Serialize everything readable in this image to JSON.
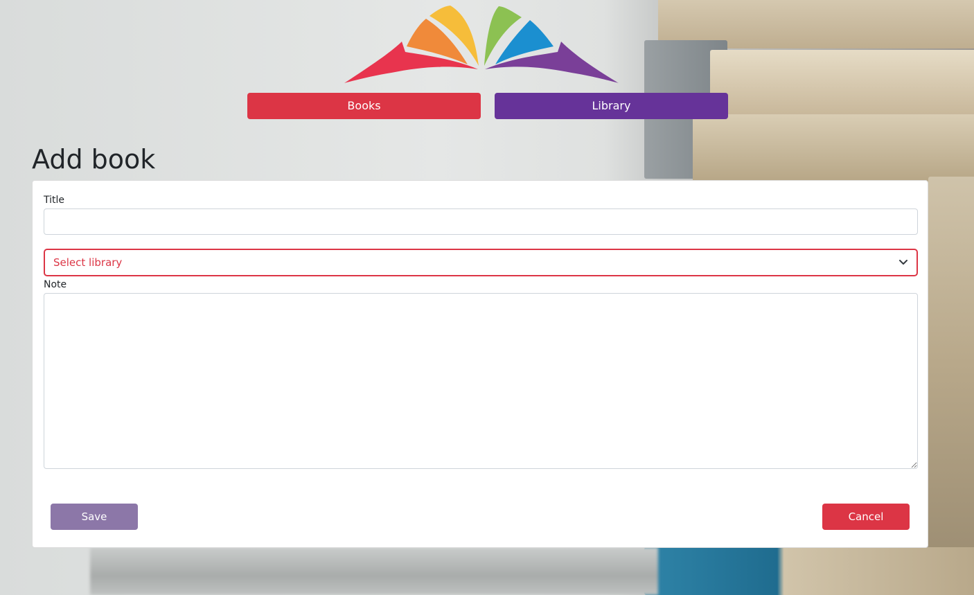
{
  "nav": {
    "books_label": "Books",
    "library_label": "Library"
  },
  "page": {
    "title": "Add book"
  },
  "form": {
    "title_label": "Title",
    "title_value": "",
    "library_select": {
      "selected": "Select library"
    },
    "note_label": "Note",
    "note_value": "",
    "save_label": "Save",
    "cancel_label": "Cancel"
  },
  "colors": {
    "books_button": "#dc3545",
    "library_button": "#663399",
    "save_button": "#8c77a8",
    "cancel_button": "#dc3545",
    "select_invalid": "#dc3545"
  },
  "icons": {
    "logo": "open-book-logo-icon",
    "select": "chevron-down-icon"
  }
}
